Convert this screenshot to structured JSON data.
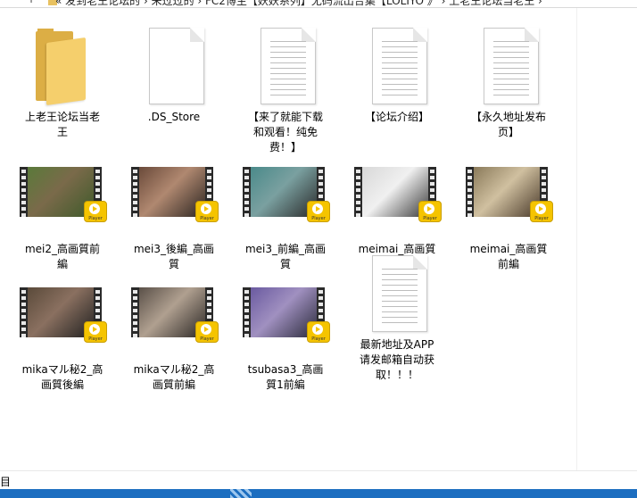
{
  "address_bar": {
    "path": "« 发到老王论坛的 › 未过过的 › FC2博主【妖妖系列】无码流出合集【LOLIYO 》 › 上老王论坛当老王 ›"
  },
  "items": [
    {
      "label": "上老王论坛当老王",
      "type": "folder"
    },
    {
      "label": ".DS_Store",
      "type": "blank"
    },
    {
      "label": "【来了就能下载和观看！纯免费！】",
      "type": "document"
    },
    {
      "label": "【论坛介绍】",
      "type": "document"
    },
    {
      "label": "【永久地址发布页】",
      "type": "document"
    },
    {
      "label": "mei2_高画質前編",
      "type": "video",
      "scene": [
        "#5a7a3a",
        "#3e5a2a",
        "#7a6a4a"
      ]
    },
    {
      "label": "mei3_後編_高画質",
      "type": "video",
      "scene": [
        "#6a4a3a",
        "#2a2420",
        "#b08870"
      ]
    },
    {
      "label": "mei3_前編_高画質",
      "type": "video",
      "scene": [
        "#4a8a8a",
        "#2a2a2a",
        "#7aa0a0"
      ]
    },
    {
      "label": "meimai_高画質後編",
      "type": "video",
      "scene": [
        "#d8d8d8",
        "#3a3a3a",
        "#f0f0f0"
      ]
    },
    {
      "label": "meimai_高画質前編",
      "type": "video",
      "scene": [
        "#8a7a5a",
        "#4a3a2a",
        "#d0c0a0"
      ]
    },
    {
      "label": "mikaマル秘2_高画質後編",
      "type": "video",
      "scene": [
        "#5a4a3a",
        "#202020",
        "#8a7060"
      ]
    },
    {
      "label": "mikaマル秘2_高画質前編",
      "type": "video",
      "scene": [
        "#5a5048",
        "#2a2624",
        "#b0a090"
      ]
    },
    {
      "label": "tsubasa3_高画質1前編",
      "type": "video",
      "scene": [
        "#6a5aa0",
        "#2a2a3a",
        "#a090c0"
      ]
    },
    {
      "label": "最新地址及APP请发邮箱自动获取！！！",
      "type": "document"
    }
  ],
  "badge_text": "Player",
  "status_bar": {
    "text": "目"
  },
  "colors": {
    "taskbar": "#1c6ec0",
    "folder": "#f5cf6c",
    "badge": "#f5c400"
  }
}
